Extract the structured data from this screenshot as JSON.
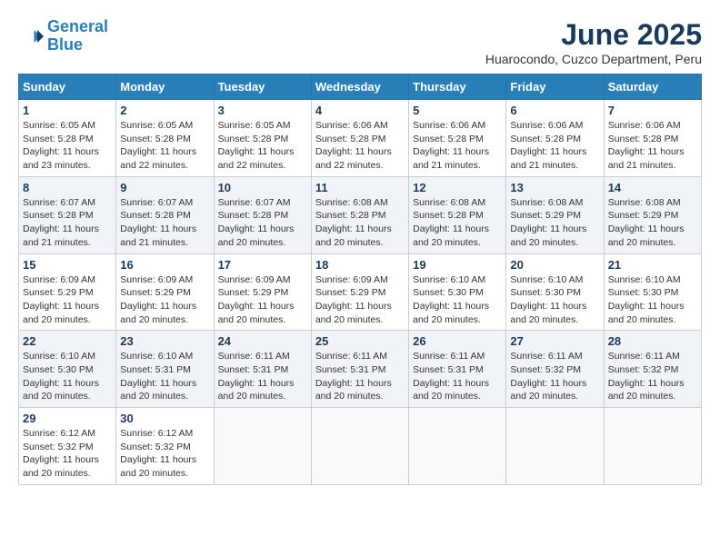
{
  "logo": {
    "line1": "General",
    "line2": "Blue"
  },
  "title": "June 2025",
  "location": "Huarocondo, Cuzco Department, Peru",
  "days_of_week": [
    "Sunday",
    "Monday",
    "Tuesday",
    "Wednesday",
    "Thursday",
    "Friday",
    "Saturday"
  ],
  "weeks": [
    [
      {
        "day": "1",
        "info": "Sunrise: 6:05 AM\nSunset: 5:28 PM\nDaylight: 11 hours\nand 23 minutes."
      },
      {
        "day": "2",
        "info": "Sunrise: 6:05 AM\nSunset: 5:28 PM\nDaylight: 11 hours\nand 22 minutes."
      },
      {
        "day": "3",
        "info": "Sunrise: 6:05 AM\nSunset: 5:28 PM\nDaylight: 11 hours\nand 22 minutes."
      },
      {
        "day": "4",
        "info": "Sunrise: 6:06 AM\nSunset: 5:28 PM\nDaylight: 11 hours\nand 22 minutes."
      },
      {
        "day": "5",
        "info": "Sunrise: 6:06 AM\nSunset: 5:28 PM\nDaylight: 11 hours\nand 21 minutes."
      },
      {
        "day": "6",
        "info": "Sunrise: 6:06 AM\nSunset: 5:28 PM\nDaylight: 11 hours\nand 21 minutes."
      },
      {
        "day": "7",
        "info": "Sunrise: 6:06 AM\nSunset: 5:28 PM\nDaylight: 11 hours\nand 21 minutes."
      }
    ],
    [
      {
        "day": "8",
        "info": "Sunrise: 6:07 AM\nSunset: 5:28 PM\nDaylight: 11 hours\nand 21 minutes."
      },
      {
        "day": "9",
        "info": "Sunrise: 6:07 AM\nSunset: 5:28 PM\nDaylight: 11 hours\nand 21 minutes."
      },
      {
        "day": "10",
        "info": "Sunrise: 6:07 AM\nSunset: 5:28 PM\nDaylight: 11 hours\nand 20 minutes."
      },
      {
        "day": "11",
        "info": "Sunrise: 6:08 AM\nSunset: 5:28 PM\nDaylight: 11 hours\nand 20 minutes."
      },
      {
        "day": "12",
        "info": "Sunrise: 6:08 AM\nSunset: 5:28 PM\nDaylight: 11 hours\nand 20 minutes."
      },
      {
        "day": "13",
        "info": "Sunrise: 6:08 AM\nSunset: 5:29 PM\nDaylight: 11 hours\nand 20 minutes."
      },
      {
        "day": "14",
        "info": "Sunrise: 6:08 AM\nSunset: 5:29 PM\nDaylight: 11 hours\nand 20 minutes."
      }
    ],
    [
      {
        "day": "15",
        "info": "Sunrise: 6:09 AM\nSunset: 5:29 PM\nDaylight: 11 hours\nand 20 minutes."
      },
      {
        "day": "16",
        "info": "Sunrise: 6:09 AM\nSunset: 5:29 PM\nDaylight: 11 hours\nand 20 minutes."
      },
      {
        "day": "17",
        "info": "Sunrise: 6:09 AM\nSunset: 5:29 PM\nDaylight: 11 hours\nand 20 minutes."
      },
      {
        "day": "18",
        "info": "Sunrise: 6:09 AM\nSunset: 5:29 PM\nDaylight: 11 hours\nand 20 minutes."
      },
      {
        "day": "19",
        "info": "Sunrise: 6:10 AM\nSunset: 5:30 PM\nDaylight: 11 hours\nand 20 minutes."
      },
      {
        "day": "20",
        "info": "Sunrise: 6:10 AM\nSunset: 5:30 PM\nDaylight: 11 hours\nand 20 minutes."
      },
      {
        "day": "21",
        "info": "Sunrise: 6:10 AM\nSunset: 5:30 PM\nDaylight: 11 hours\nand 20 minutes."
      }
    ],
    [
      {
        "day": "22",
        "info": "Sunrise: 6:10 AM\nSunset: 5:30 PM\nDaylight: 11 hours\nand 20 minutes."
      },
      {
        "day": "23",
        "info": "Sunrise: 6:10 AM\nSunset: 5:31 PM\nDaylight: 11 hours\nand 20 minutes."
      },
      {
        "day": "24",
        "info": "Sunrise: 6:11 AM\nSunset: 5:31 PM\nDaylight: 11 hours\nand 20 minutes."
      },
      {
        "day": "25",
        "info": "Sunrise: 6:11 AM\nSunset: 5:31 PM\nDaylight: 11 hours\nand 20 minutes."
      },
      {
        "day": "26",
        "info": "Sunrise: 6:11 AM\nSunset: 5:31 PM\nDaylight: 11 hours\nand 20 minutes."
      },
      {
        "day": "27",
        "info": "Sunrise: 6:11 AM\nSunset: 5:32 PM\nDaylight: 11 hours\nand 20 minutes."
      },
      {
        "day": "28",
        "info": "Sunrise: 6:11 AM\nSunset: 5:32 PM\nDaylight: 11 hours\nand 20 minutes."
      }
    ],
    [
      {
        "day": "29",
        "info": "Sunrise: 6:12 AM\nSunset: 5:32 PM\nDaylight: 11 hours\nand 20 minutes."
      },
      {
        "day": "30",
        "info": "Sunrise: 6:12 AM\nSunset: 5:32 PM\nDaylight: 11 hours\nand 20 minutes."
      },
      {
        "day": "",
        "info": ""
      },
      {
        "day": "",
        "info": ""
      },
      {
        "day": "",
        "info": ""
      },
      {
        "day": "",
        "info": ""
      },
      {
        "day": "",
        "info": ""
      }
    ]
  ]
}
